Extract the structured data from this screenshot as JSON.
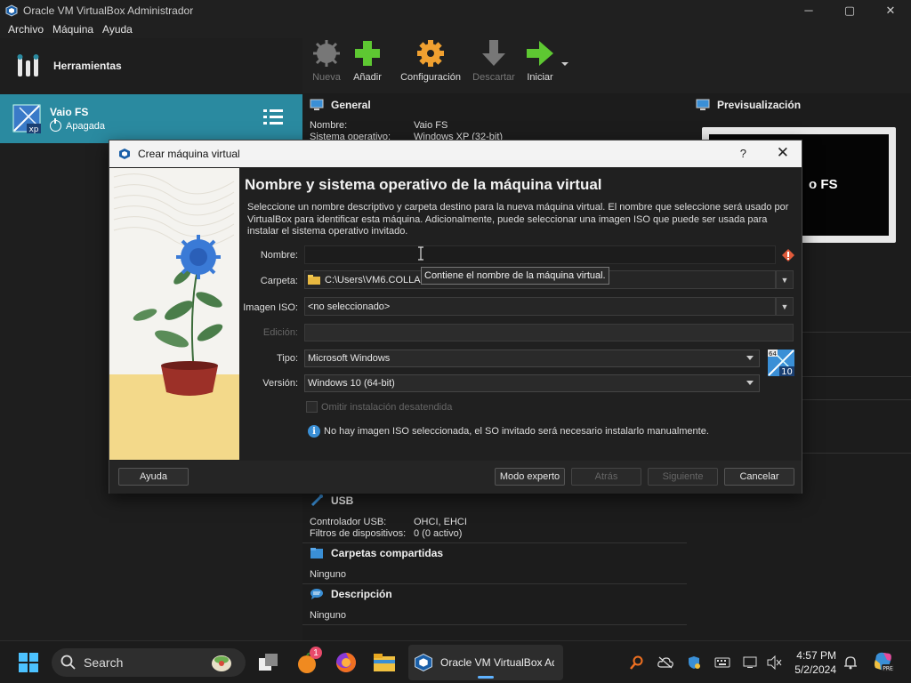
{
  "window": {
    "title": "Oracle VM VirtualBox Administrador",
    "controls": [
      "─",
      "▢",
      "✕"
    ]
  },
  "menubar": {
    "items": [
      {
        "label": "Archivo"
      },
      {
        "label": "Máquina"
      },
      {
        "label": "Ayuda"
      }
    ]
  },
  "sidebar": {
    "tools_label": "Herramientas",
    "vm": {
      "name": "Vaio FS",
      "state": "Apagada",
      "os_badge": "xp"
    }
  },
  "toolbar": {
    "buttons": [
      {
        "label": "Nueva",
        "enabled": false
      },
      {
        "label": "Añadir",
        "enabled": true
      },
      {
        "label": "Configuración",
        "enabled": true
      },
      {
        "label": "Descartar",
        "enabled": false
      },
      {
        "label": "Iniciar",
        "enabled": true
      }
    ]
  },
  "details": {
    "general": {
      "heading": "General",
      "nombre_key": "Nombre:",
      "nombre_val": "Vaio FS",
      "so_key": "Sistema operativo:",
      "so_val": "Windows XP (32-bit)"
    },
    "usb": {
      "heading": "USB",
      "ctrl_key": "Controlador USB:",
      "ctrl_val": "OHCI, EHCI",
      "filt_key": "Filtros de dispositivos:",
      "filt_val": "0 (0 activo)"
    },
    "shared": {
      "heading": "Carpetas compartidas",
      "value": "Ninguno"
    },
    "desc": {
      "heading": "Descripción",
      "value": "Ninguno"
    }
  },
  "preview": {
    "heading": "Previsualización",
    "screen_text": "o FS"
  },
  "dialog": {
    "title": "Crear máquina virtual",
    "help_glyph": "?",
    "close_glyph": "✕",
    "heading": "Nombre y sistema operativo de la máquina virtual",
    "description": "Seleccione un nombre descriptivo y carpeta destino para la nueva máquina virtual. El nombre que seleccione será usado por VirtualBox para identificar esta máquina. Adicionalmente, puede seleccionar una imagen ISO que puede ser usada para instalar el sistema operativo invitado.",
    "labels": {
      "nombre": "Nombre:",
      "carpeta": "Carpeta:",
      "iso": "Imagen ISO:",
      "edicion": "Edición:",
      "tipo": "Tipo:",
      "version": "Versión:"
    },
    "fields": {
      "nombre": "",
      "carpeta": "C:\\Users\\VM6.COLLAB",
      "iso": "<no seleccionado>",
      "edicion": "",
      "tipo": "Microsoft Windows",
      "version": "Windows 10 (64-bit)"
    },
    "tooltip": "Contiene el nombre de la máquina virtual.",
    "checkbox_label": "Omitir instalación desatendida",
    "info_text": "No hay imagen ISO seleccionada, el SO invitado será necesario instalarlo manualmente.",
    "os_badge": {
      "bits": "64",
      "version": "10"
    },
    "buttons": {
      "ayuda": "Ayuda",
      "experto": "Modo experto",
      "atras": "Atrás",
      "siguiente": "Siguiente",
      "cancelar": "Cancelar"
    }
  },
  "taskbar": {
    "search_label": "Search",
    "active_app_label": "Oracle VM VirtualBox Ad",
    "notification_count": "1",
    "time": "4:57 PM",
    "date": "5/2/2024"
  },
  "colors": {
    "selected_vm_bg": "#2a8aa0",
    "accent_blue": "#3a8fd6",
    "warning": "#e05a3a"
  }
}
